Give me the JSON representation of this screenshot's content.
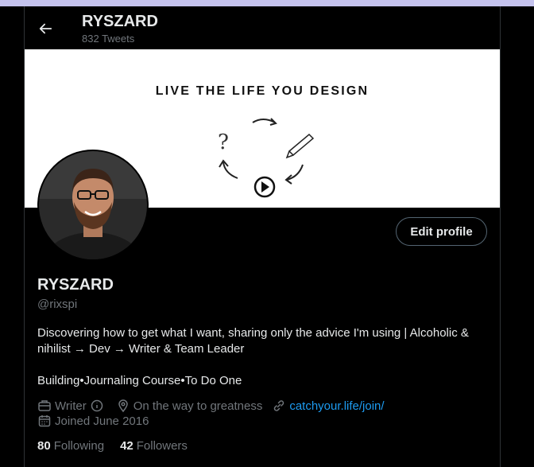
{
  "header": {
    "name": "RYSZARD",
    "tweets": "832 Tweets"
  },
  "banner": {
    "text": "LIVE THE LIFE YOU DESIGN"
  },
  "profile": {
    "edit_label": "Edit profile",
    "name": "RYSZARD",
    "handle": "@rixspi",
    "bio_line": "Discovering how to get what I want, sharing only the advice I'm using | Alcoholic & nihilist → Dev → Writer & Team Leader",
    "bio_line2": "Building•Journaling Course•To Do One",
    "category": "Writer",
    "location": "On the way to greatness",
    "website": "catchyour.life/join/",
    "joined": "Joined June 2016",
    "following_count": "80",
    "following_label": "Following",
    "followers_count": "42",
    "followers_label": "Followers"
  },
  "colors": {
    "link": "#1d9bf0",
    "muted": "#71767b",
    "text": "#e7e9ea"
  }
}
